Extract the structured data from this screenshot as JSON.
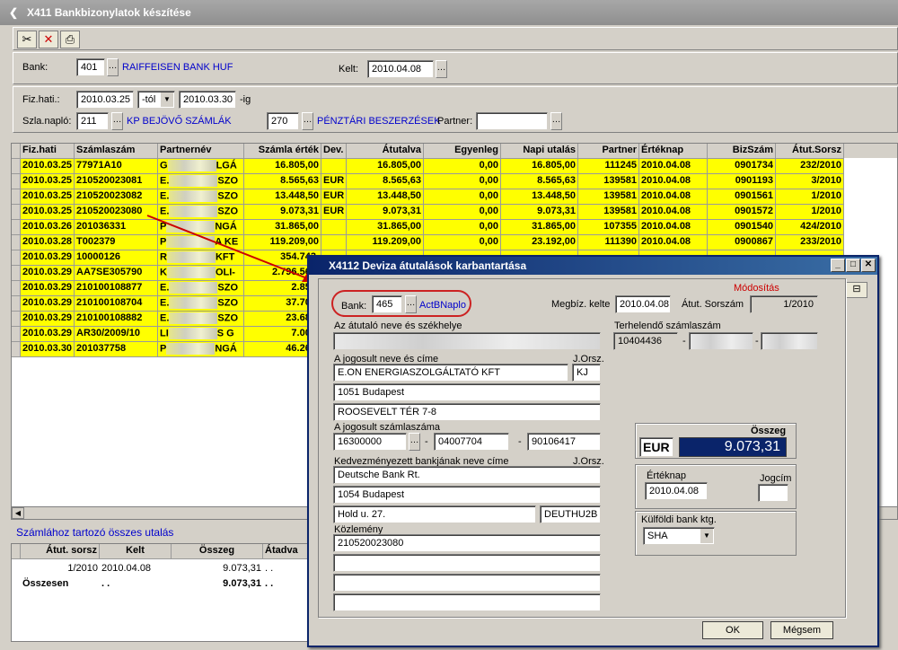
{
  "window": {
    "title": "X411 Bankbizonylatok készítése"
  },
  "toolbar": {
    "icons": [
      "scissors-icon",
      "close-icon",
      "printer-icon"
    ]
  },
  "filter": {
    "bank_label": "Bank:",
    "bank_code": "401",
    "bank_name": "RAIFFEISEN BANK HUF",
    "kelt_label": "Kelt:",
    "kelt_value": "2010.04.08",
    "fizhati_label": "Fiz.hati.:",
    "date_from": "2010.03.25",
    "tol": "-tól",
    "date_to": "2010.03.30",
    "ig": "-ig",
    "szlanaplo_label": "Szla.napló:",
    "szlanaplo_code": "211",
    "szlanaplo_name": "KP BEJÖVŐ SZÁMLÁK",
    "code2": "270",
    "code2_name": "PÉNZTÁRI BESZERZÉSEK",
    "partner_label": "Partner:",
    "partner_value": ""
  },
  "grid": {
    "headers": [
      "Fiz.hati",
      "Számlaszám",
      "Partnernév",
      "Számla érték",
      "Dev.",
      "Átutalva",
      "Egyenleg",
      "Napi utalás",
      "Partner",
      "Értéknap",
      "BizSzám",
      "Átut.Sorsz"
    ],
    "rows": [
      [
        "2010.03.25",
        "77971A10",
        "G",
        "LGÁ",
        "16.805,00",
        "",
        "16.805,00",
        "0,00",
        "16.805,00",
        "111245",
        "2010.04.08",
        "0901734",
        "232/2010"
      ],
      [
        "2010.03.25",
        "210520023081",
        "E.",
        "SZO",
        "8.565,63",
        "EUR",
        "8.565,63",
        "0,00",
        "8.565,63",
        "139581",
        "2010.04.08",
        "0901193",
        "3/2010"
      ],
      [
        "2010.03.25",
        "210520023082",
        "E.",
        "SZO",
        "13.448,50",
        "EUR",
        "13.448,50",
        "0,00",
        "13.448,50",
        "139581",
        "2010.04.08",
        "0901561",
        "1/2010"
      ],
      [
        "2010.03.25",
        "210520023080",
        "E.",
        "SZO",
        "9.073,31",
        "EUR",
        "9.073,31",
        "0,00",
        "9.073,31",
        "139581",
        "2010.04.08",
        "0901572",
        "1/2010"
      ],
      [
        "2010.03.26",
        "201036331",
        "P",
        "NGÁ",
        "31.865,00",
        "",
        "31.865,00",
        "0,00",
        "31.865,00",
        "107355",
        "2010.04.08",
        "0901540",
        "424/2010"
      ],
      [
        "2010.03.28",
        "T002379",
        "P",
        "A KE",
        "119.209,00",
        "",
        "119.209,00",
        "0,00",
        "23.192,00",
        "111390",
        "2010.04.08",
        "0900867",
        "233/2010"
      ],
      [
        "2010.03.29",
        "10000126",
        "R",
        "KFT",
        "354.743,",
        "",
        "",
        "",
        "",
        "",
        "",
        "",
        ""
      ],
      [
        "2010.03.29",
        "AA7SE305790",
        "K",
        "OLI-",
        "2.796.562,",
        "",
        "",
        "",
        "",
        "",
        "",
        "",
        ""
      ],
      [
        "2010.03.29",
        "210100108877",
        "E.",
        "SZO",
        "2.857,",
        "",
        "",
        "",
        "",
        "",
        "",
        "",
        ""
      ],
      [
        "2010.03.29",
        "210100108704",
        "E.",
        "SZO",
        "37.703,",
        "",
        "",
        "",
        "",
        "",
        "",
        "",
        ""
      ],
      [
        "2010.03.29",
        "210100108882",
        "E.",
        "SZO",
        "23.682,",
        "",
        "",
        "",
        "",
        "",
        "",
        "",
        ""
      ],
      [
        "2010.03.29",
        "AR30/2009/10",
        "LI",
        "S G",
        "7.000,",
        "",
        "",
        "",
        "",
        "",
        "",
        "",
        ""
      ],
      [
        "2010.03.30",
        "201037758",
        "P",
        "NGÁ",
        "46.264,",
        "",
        "",
        "",
        "",
        "",
        "",
        "",
        ""
      ]
    ]
  },
  "summary": {
    "title": "Számlához tartozó összes utalás",
    "headers": [
      "Átut. sorsz",
      "Kelt",
      "Összeg",
      "Átadva"
    ],
    "row1": [
      "1/2010",
      "2010.04.08",
      "9.073,31",
      ". ."
    ],
    "total": [
      "Összesen",
      ". .",
      "9.073,31",
      ". ."
    ]
  },
  "dialog": {
    "title": "X4112  Deviza átutalások karbantartása",
    "mode": "Módosítás",
    "bank_label": "Bank:",
    "bank_code": "465",
    "bank_name": "ActBNaplo",
    "megbiz_label": "Megbíz. kelte",
    "megbiz_value": "2010.04.08",
    "atut_label": "Átut. Sorszám",
    "atut_value": "1/2010",
    "atutalo_label": "Az átutaló neve és székhelye",
    "terhelendo_label": "Terhelendő számlaszám",
    "terhelendo_value": "10404436",
    "jogosult_label": "A jogosult neve és címe",
    "jorsz_label": "J.Orsz.",
    "jogosult_name": "E.ON ENERGIASZOLGÁLTATÓ KFT",
    "jogosult_country": "KJ",
    "jogosult_city": "1051 Budapest",
    "jogosult_street": "ROOSEVELT TÉR 7-8",
    "szamla_label": "A jogosult számlaszáma",
    "szamla1": "16300000",
    "szamla2": "04007704",
    "szamla3": "90106417",
    "kedv_label": "Kedvezményezett bankjának neve címe",
    "jorsz2_label": "J.Orsz.",
    "kedv_name": "Deutsche Bank Rt.",
    "kedv_city": "1054 Budapest",
    "kedv_street": "Hold u. 27.",
    "kedv_code": "DEUTHU2B",
    "kozlemeny_label": "Közlemény",
    "kozlemeny_value": "210520023080",
    "osszeg_label": "Összeg",
    "currency": "EUR",
    "amount": "9.073,31",
    "ertek_label": "Értéknap",
    "ertek_value": "2010.04.08",
    "jogcim_label": "Jogcím",
    "kulfoldi_label": "Külföldi bank ktg.",
    "kulfoldi_value": "SHA",
    "ok": "OK",
    "cancel": "Mégsem"
  }
}
